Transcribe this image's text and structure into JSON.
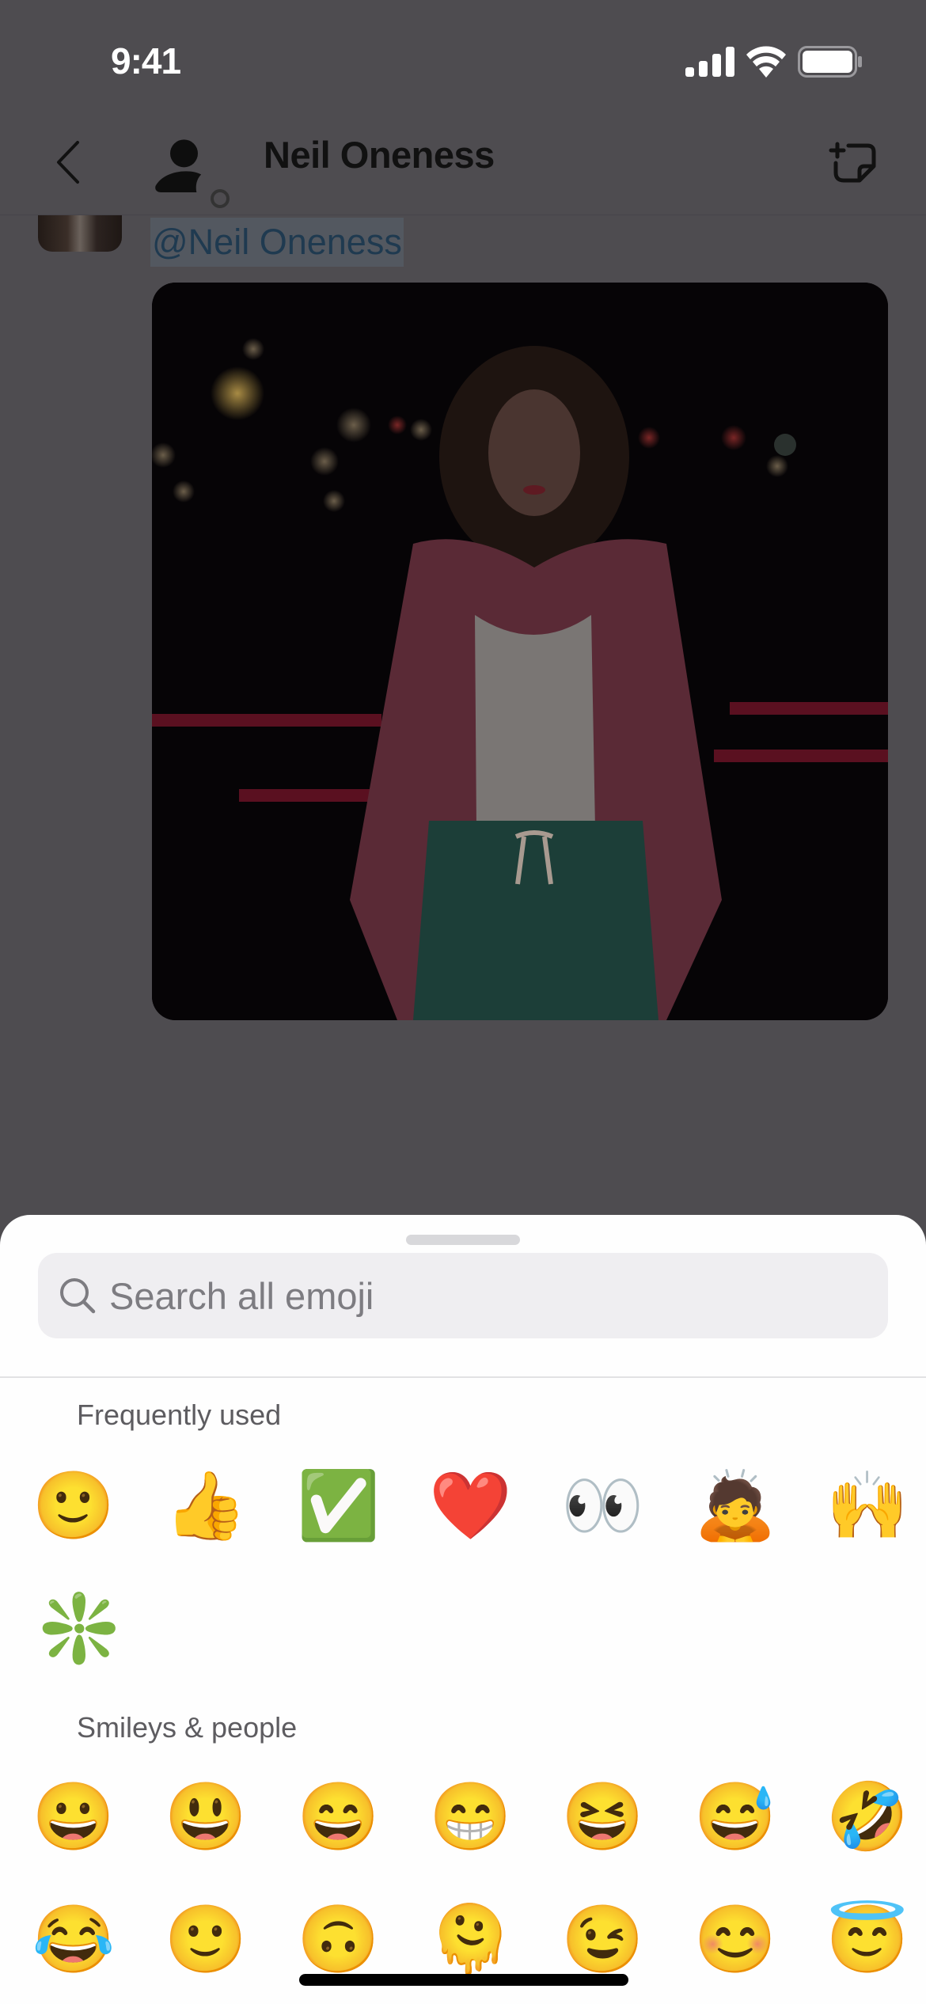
{
  "status_bar": {
    "time": "9:41",
    "icons": [
      "cellular-signal-icon",
      "wifi-icon",
      "battery-icon"
    ]
  },
  "nav": {
    "back_icon": "chevron-left-icon",
    "avatar_icon": "person-icon",
    "presence_icon": "presence-away-icon",
    "title": "Neil Oneness",
    "compose_icon": "new-note-icon"
  },
  "message": {
    "mention": "@Neil Oneness",
    "attachment": "photo of woman at night in floral jacket"
  },
  "emoji_sheet": {
    "search": {
      "placeholder": "Search all emoji",
      "value": ""
    },
    "sections": [
      {
        "label": "Frequently used",
        "emojis": [
          {
            "name": "slightly-smiling-face",
            "char": "🙂"
          },
          {
            "name": "thumbs-up",
            "char": "👍"
          },
          {
            "name": "white-check-mark",
            "char": "✅"
          },
          {
            "name": "red-heart",
            "char": "❤️"
          },
          {
            "name": "eyes",
            "char": "👀"
          },
          {
            "name": "person-bowing",
            "char": "🙇"
          },
          {
            "name": "raising-hands",
            "char": "🙌"
          },
          {
            "name": "sparkle",
            "char": "❇️"
          }
        ]
      },
      {
        "label": "Smileys & people",
        "emojis": [
          {
            "name": "grinning-face",
            "char": "😀"
          },
          {
            "name": "grinning-face-big-eyes",
            "char": "😃"
          },
          {
            "name": "grinning-face-smiling-eyes",
            "char": "😄"
          },
          {
            "name": "beaming-face",
            "char": "😁"
          },
          {
            "name": "grinning-squinting-face",
            "char": "😆"
          },
          {
            "name": "grinning-face-sweat",
            "char": "😅"
          },
          {
            "name": "rolling-on-floor-laughing",
            "char": "🤣"
          },
          {
            "name": "face-with-tears-of-joy",
            "char": "😂"
          },
          {
            "name": "slightly-smiling-face",
            "char": "🙂"
          },
          {
            "name": "upside-down-face",
            "char": "🙃"
          },
          {
            "name": "melting-face",
            "char": "🫠"
          },
          {
            "name": "winking-face",
            "char": "😉"
          },
          {
            "name": "smiling-face-smiling-eyes",
            "char": "😊"
          },
          {
            "name": "smiling-face-halo",
            "char": "😇"
          }
        ]
      }
    ]
  },
  "colors": {
    "overlay_bg": "#4e4c50",
    "sheet_bg": "#fefefe",
    "search_bg": "#efeef1",
    "placeholder": "#7d7c81",
    "section_label": "#5d5c60"
  }
}
